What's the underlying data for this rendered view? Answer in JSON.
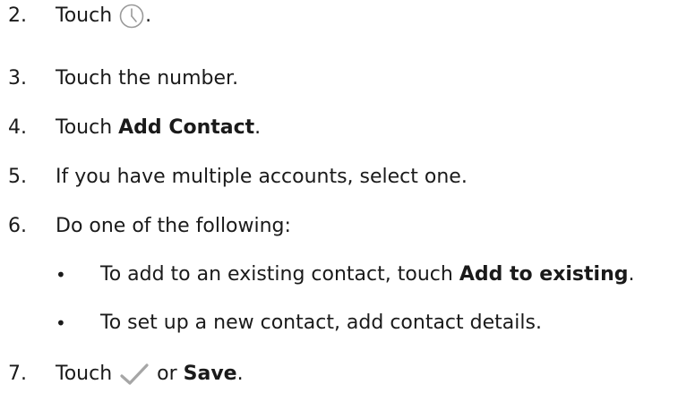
{
  "steps": [
    {
      "num": "2.",
      "pre": "Touch ",
      "icon": "clock-icon",
      "post": "."
    },
    {
      "num": "3.",
      "text": "Touch the number."
    },
    {
      "num": "4.",
      "pre": "Touch ",
      "bold": "Add Contact",
      "post": "."
    },
    {
      "num": "5.",
      "text": "If you have multiple accounts, select one."
    },
    {
      "num": "6.",
      "text": "Do one of the following:"
    },
    {
      "num": "7.",
      "pre": "Touch ",
      "icon": "checkmark-icon",
      "mid": " or ",
      "bold": "Save",
      "post": "."
    }
  ],
  "bullets": [
    {
      "symbol": "•",
      "pre": "To add to an existing contact, touch ",
      "bold": "Add to existing",
      "post": "."
    },
    {
      "symbol": "•",
      "text": "To set up a new contact, add contact details."
    }
  ],
  "colors": {
    "text": "#1a1a1a",
    "icon_gray": "#9a9a9a",
    "check_gray": "#a6a6a6"
  }
}
